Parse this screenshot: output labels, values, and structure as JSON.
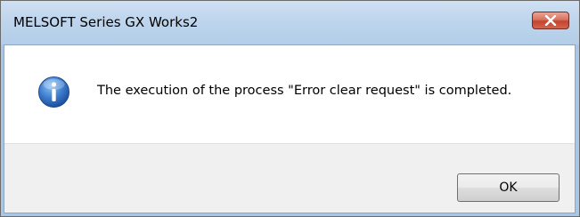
{
  "window": {
    "title": "MELSOFT Series GX Works2",
    "close_icon": "close-x-icon"
  },
  "dialog": {
    "icon": "information-icon",
    "message": "The execution of the process \"Error clear request\" is completed.",
    "ok_label": "OK"
  },
  "colors": {
    "titlebar": "#bed5ec",
    "close_button": "#d4644c",
    "message_background": "#ffffff",
    "button_bar": "#f0f0f0",
    "info_icon": "#2b67b7"
  }
}
